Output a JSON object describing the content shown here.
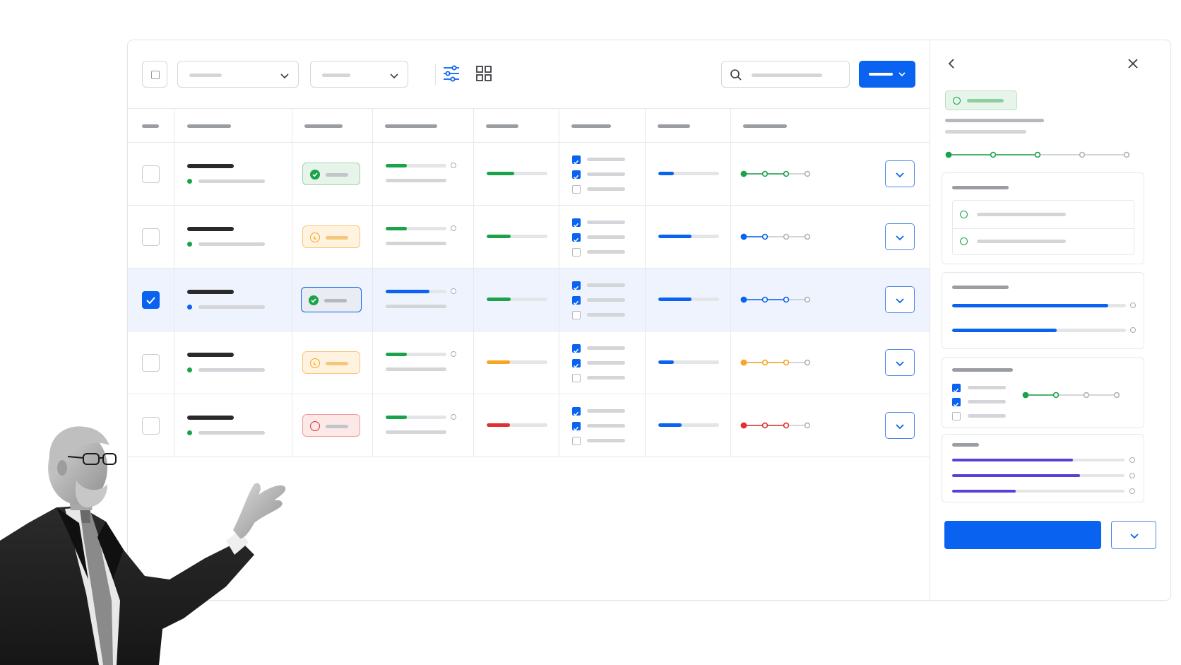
{
  "app": {
    "toolbar": {
      "icons": [
        "checkbox-icon",
        "chevron-down-icon",
        "filter-sliders-icon",
        "grid-view-icon",
        "search-icon",
        "chevron-down-icon"
      ]
    },
    "table": {
      "columns": 8,
      "rows": [
        {
          "checked": false,
          "status_color": "#1aa34a",
          "status": "success",
          "progress": [
            0.35,
            0.45,
            0.25
          ],
          "progress_colors": [
            "#1aa34a",
            "#1aa34a",
            "#0a63f0"
          ],
          "checks": [
            true,
            true,
            false
          ],
          "stepper_color": "#1aa34a",
          "stepper_done": 3
        },
        {
          "checked": false,
          "status_color": "#f5a623",
          "status": "pending",
          "progress": [
            0.35,
            0.4,
            0.55
          ],
          "progress_colors": [
            "#1aa34a",
            "#1aa34a",
            "#0a63f0"
          ],
          "checks": [
            true,
            true,
            false
          ],
          "stepper_color": "#0a63f0",
          "stepper_done": 2
        },
        {
          "checked": true,
          "status_color": "#1aa34a",
          "status": "success",
          "progress": [
            0.72,
            0.4,
            0.55
          ],
          "progress_colors": [
            "#0a63f0",
            "#1aa34a",
            "#0a63f0"
          ],
          "checks": [
            true,
            true,
            false
          ],
          "stepper_color": "#0a63f0",
          "stepper_done": 3
        },
        {
          "checked": false,
          "status_color": "#f5a623",
          "status": "pending",
          "progress": [
            0.35,
            0.38,
            0.25
          ],
          "progress_colors": [
            "#1aa34a",
            "#f5a623",
            "#0a63f0"
          ],
          "checks": [
            true,
            true,
            false
          ],
          "stepper_color": "#f5a623",
          "stepper_done": 3
        },
        {
          "checked": false,
          "status_color": "#e03131",
          "status": "error",
          "progress": [
            0.35,
            0.38,
            0.38
          ],
          "progress_colors": [
            "#1aa34a",
            "#e03131",
            "#0a63f0"
          ],
          "checks": [
            true,
            true,
            false
          ],
          "stepper_color": "#e03131",
          "stepper_done": 3
        }
      ]
    },
    "panel": {
      "icons": [
        "chevron-left-icon",
        "close-icon",
        "check-circle-icon"
      ],
      "stepper_done": 3,
      "stepper_total": 5,
      "card2_progress": [
        0.9,
        0.6
      ],
      "card3_checks": [
        true,
        true,
        false
      ],
      "card4_progress": [
        0.7,
        0.74,
        0.37
      ],
      "accent": "#0a63f0",
      "violet": "#5b3fd9"
    }
  },
  "colors": {
    "primary": "#0a63f0",
    "success": "#1aa34a",
    "warning": "#f5a623",
    "danger": "#e03131"
  }
}
